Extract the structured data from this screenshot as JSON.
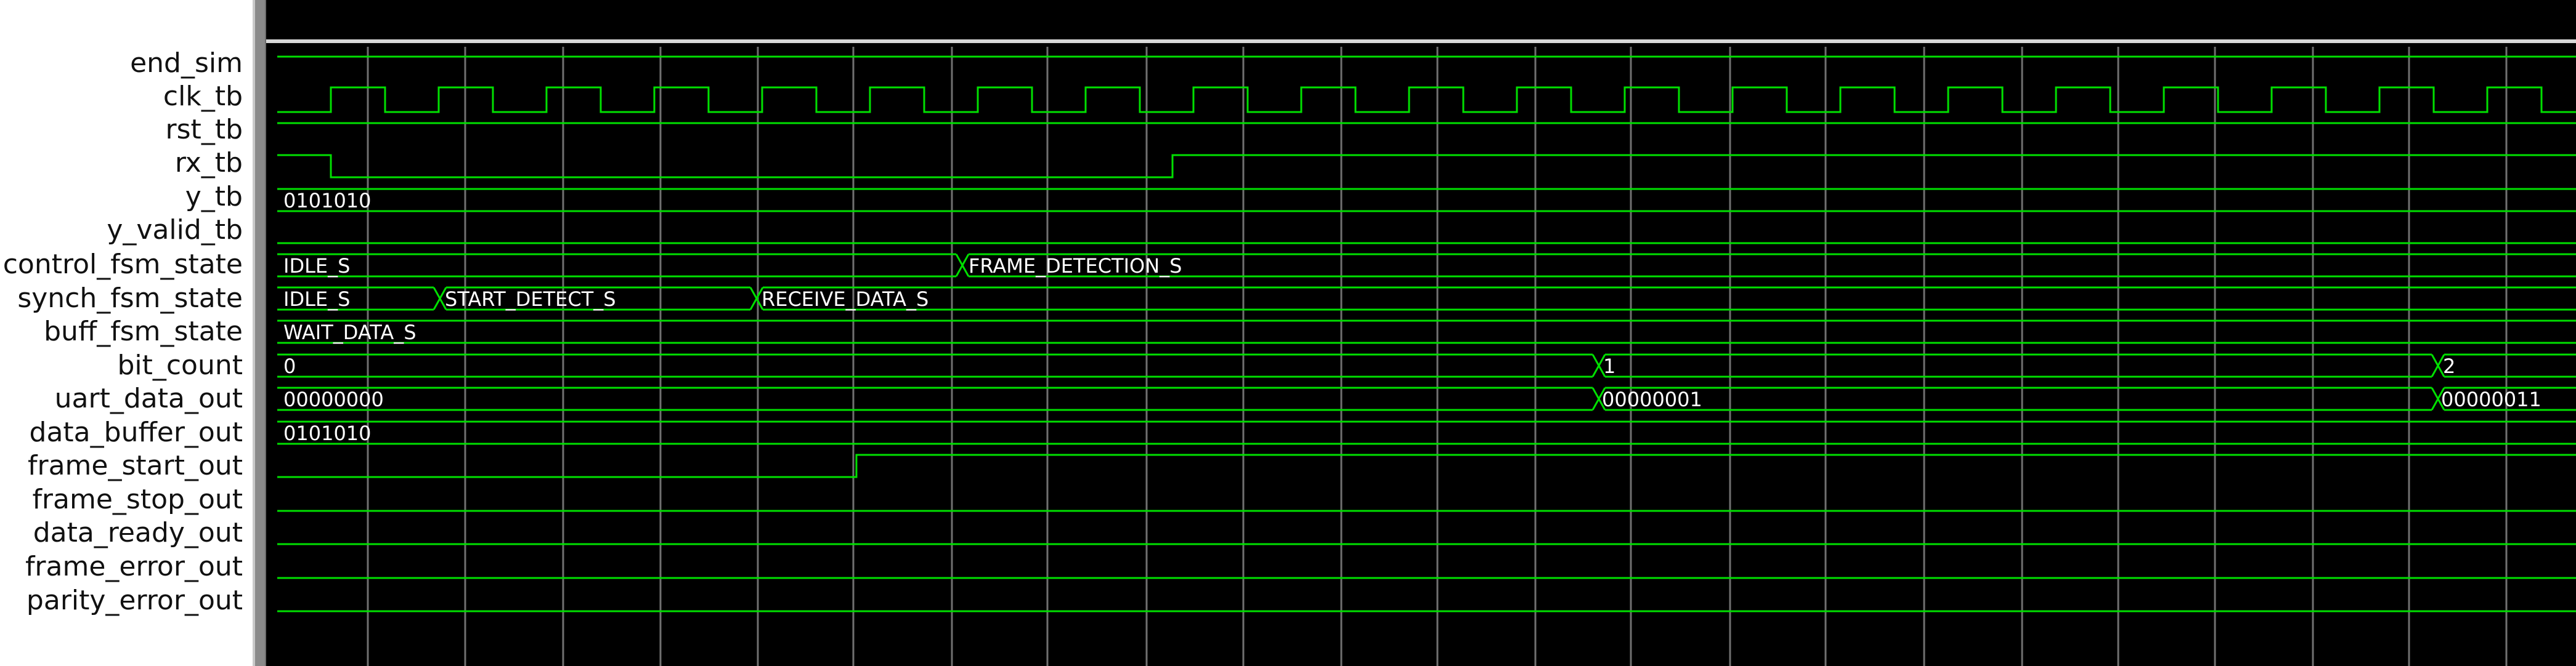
{
  "signals": [
    {
      "name": "end_sim"
    },
    {
      "name": "clk_tb"
    },
    {
      "name": "rst_tb"
    },
    {
      "name": "rx_tb"
    },
    {
      "name": "y_tb",
      "values": [
        "0101010"
      ]
    },
    {
      "name": "y_valid_tb"
    },
    {
      "name": "control_fsm_state",
      "values": [
        "IDLE_S",
        "FRAME_DETECTION_S"
      ]
    },
    {
      "name": "synch_fsm_state",
      "values": [
        "IDLE_S",
        "START_DETECT_S",
        "RECEIVE_DATA_S"
      ]
    },
    {
      "name": "buff_fsm_state",
      "values": [
        "WAIT_DATA_S"
      ]
    },
    {
      "name": "bit_count",
      "values": [
        "0",
        "1",
        "2"
      ]
    },
    {
      "name": "uart_data_out",
      "values": [
        "00000000",
        "00000001",
        "00000011"
      ]
    },
    {
      "name": "data_buffer_out",
      "values": [
        "0101010"
      ]
    },
    {
      "name": "frame_start_out"
    },
    {
      "name": "frame_stop_out"
    },
    {
      "name": "data_ready_out"
    },
    {
      "name": "frame_error_out"
    },
    {
      "name": "parity_error_out"
    }
  ],
  "colors": {
    "wave": "#00e000",
    "grid": "#707070",
    "text": "#ffffff",
    "background": "#000000"
  }
}
